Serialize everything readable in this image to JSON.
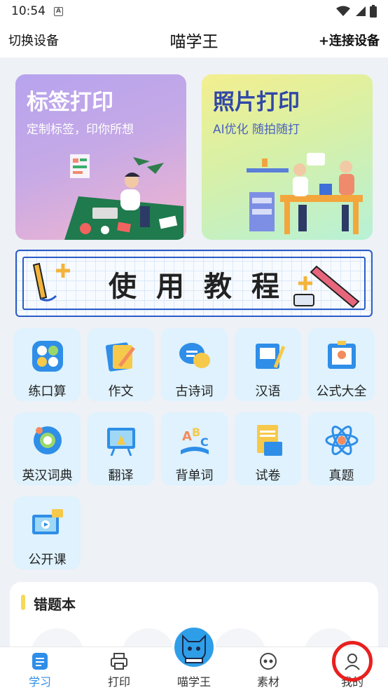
{
  "status_bar": {
    "time": "10:54",
    "notification_icon": "a-box-icon",
    "icons": [
      "wifi-icon",
      "signal-icon",
      "battery-icon"
    ]
  },
  "header": {
    "left_action": "切换设备",
    "title": "喵学王",
    "right_action": "+连接设备"
  },
  "banners": [
    {
      "title": "标签打印",
      "subtitle": "定制标签，印你所想"
    },
    {
      "title": "照片打印",
      "subtitle": "AI优化 随拍随打"
    }
  ],
  "tutorial": {
    "text": "使用教程"
  },
  "tiles": [
    {
      "label": "练口算",
      "icon": "math-icon"
    },
    {
      "label": "作文",
      "icon": "essay-icon"
    },
    {
      "label": "古诗词",
      "icon": "poetry-icon"
    },
    {
      "label": "汉语",
      "icon": "chinese-icon"
    },
    {
      "label": "公式大全",
      "icon": "formula-icon"
    },
    {
      "label": "英汉词典",
      "icon": "dictionary-icon"
    },
    {
      "label": "翻译",
      "icon": "translate-icon"
    },
    {
      "label": "背单词",
      "icon": "vocabulary-icon"
    },
    {
      "label": "试卷",
      "icon": "exam-paper-icon"
    },
    {
      "label": "真题",
      "icon": "real-exam-icon"
    },
    {
      "label": "公开课",
      "icon": "open-class-icon"
    }
  ],
  "wrong_questions": {
    "title": "错题本"
  },
  "tabbar": {
    "items": [
      {
        "label": "学习",
        "icon": "study-icon",
        "active": true
      },
      {
        "label": "打印",
        "icon": "printer-icon",
        "active": false
      },
      {
        "label": "喵学王",
        "icon": "cat-logo-icon",
        "active": false
      },
      {
        "label": "素材",
        "icon": "material-icon",
        "active": false
      },
      {
        "label": "我的",
        "icon": "user-icon",
        "active": false
      }
    ]
  },
  "colors": {
    "accent": "#2f8ee8",
    "tile_bg": "#dff2fd",
    "highlight_ring": "#e8201e"
  }
}
